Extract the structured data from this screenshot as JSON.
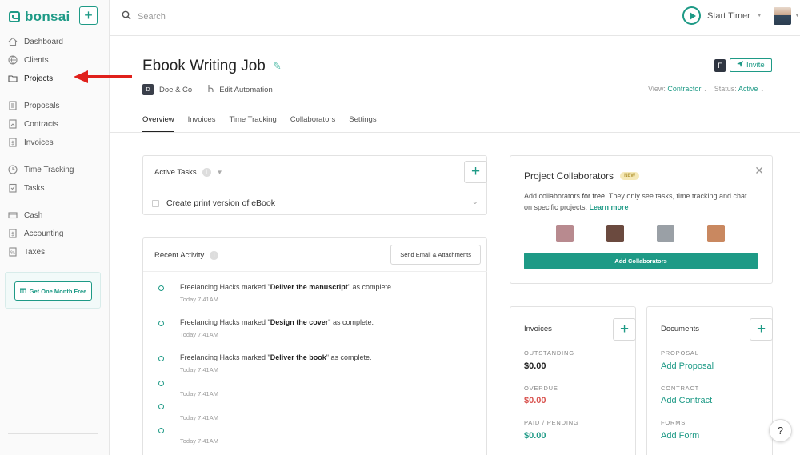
{
  "app": {
    "logo_text": "bonsai",
    "accent_color": "#1e9a86"
  },
  "sidebar": {
    "new_button": "+",
    "items": [
      {
        "label": "Dashboard",
        "icon": "home-icon"
      },
      {
        "label": "Clients",
        "icon": "clients-icon"
      },
      {
        "label": "Projects",
        "icon": "folder-icon"
      },
      {
        "label": "Proposals",
        "icon": "proposal-icon"
      },
      {
        "label": "Contracts",
        "icon": "contract-icon"
      },
      {
        "label": "Invoices",
        "icon": "invoice-icon"
      },
      {
        "label": "Time Tracking",
        "icon": "clock-icon"
      },
      {
        "label": "Tasks",
        "icon": "tasks-icon"
      },
      {
        "label": "Cash",
        "icon": "cash-icon"
      },
      {
        "label": "Accounting",
        "icon": "accounting-icon"
      },
      {
        "label": "Taxes",
        "icon": "taxes-icon"
      }
    ],
    "active": "Projects",
    "promo_label": "Get One Month Free"
  },
  "topbar": {
    "search_placeholder": "Search",
    "timer_label": "Start Timer"
  },
  "project": {
    "title": "Ebook Writing Job",
    "client_initial": "D",
    "client_name": "Doe & Co",
    "automation_label": "Edit Automation",
    "invite_label": "Invite",
    "doc_icon_letter": "F",
    "view_label": "View:",
    "view_value": "Contractor",
    "status_label": "Status:",
    "status_value": "Active"
  },
  "tabs": [
    "Overview",
    "Invoices",
    "Time Tracking",
    "Collaborators",
    "Settings"
  ],
  "active_tab": "Overview",
  "tasks": {
    "heading": "Active Tasks",
    "add_label": "+",
    "items": [
      "Create print version of eBook"
    ]
  },
  "activity": {
    "heading": "Recent Activity",
    "send_button": "Send Email & Attachments",
    "items": [
      {
        "prefix": "Freelancing Hacks marked \"",
        "bold": "Deliver the manuscript",
        "suffix": "\" as complete.",
        "time": "Today 7:41AM"
      },
      {
        "prefix": "Freelancing Hacks marked \"",
        "bold": "Design the cover",
        "suffix": "\" as complete.",
        "time": "Today 7:41AM"
      },
      {
        "prefix": "Freelancing Hacks marked \"",
        "bold": "Deliver the book",
        "suffix": "\" as complete.",
        "time": "Today 7:41AM"
      },
      {
        "prefix": "",
        "bold": "",
        "suffix": "",
        "time": "Today 7:41AM"
      },
      {
        "prefix": "",
        "bold": "",
        "suffix": "",
        "time": "Today 7:41AM"
      },
      {
        "prefix": "",
        "bold": "",
        "suffix": "",
        "time": "Today 7:41AM"
      }
    ]
  },
  "collaborators": {
    "title": "Project Collaborators",
    "badge": "NEW",
    "desc_1": "Add collaborators ",
    "desc_bold": "for free",
    "desc_2": ". They only see tasks, time tracking and chat on specific projects. ",
    "learn_more": "Learn more",
    "button": "Add Collaborators",
    "avatar_colors": [
      "#b88a8f",
      "#6b4a3f",
      "#9aa0a6",
      "#c98860"
    ]
  },
  "invoices_card": {
    "title": "Invoices",
    "outstanding_label": "OUTSTANDING",
    "outstanding_value": "$0.00",
    "overdue_label": "OVERDUE",
    "overdue_value": "$0.00",
    "paid_label": "PAID / PENDING",
    "paid_value": "$0.00"
  },
  "documents_card": {
    "title": "Documents",
    "proposal_label": "PROPOSAL",
    "proposal_link": "Add Proposal",
    "contract_label": "CONTRACT",
    "contract_link": "Add Contract",
    "forms_label": "FORMS",
    "forms_link": "Add Form"
  },
  "help_label": "?"
}
